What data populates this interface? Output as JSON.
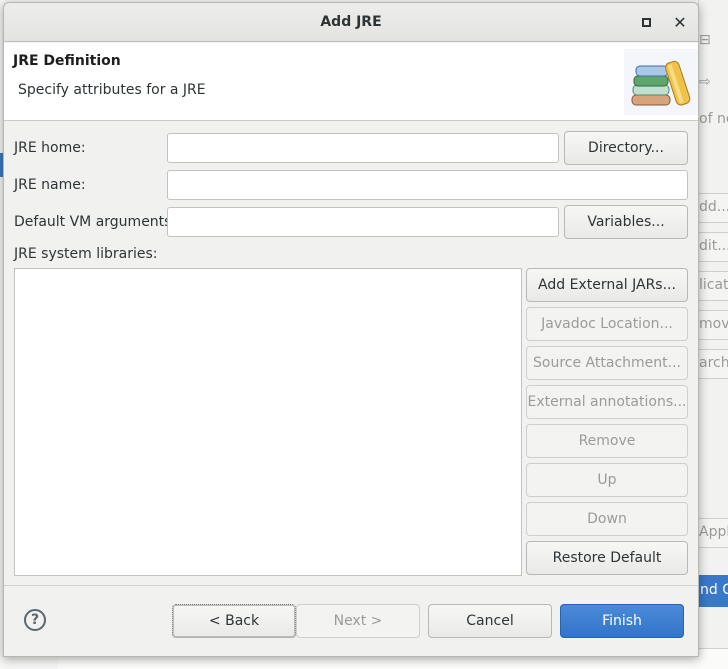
{
  "background": {
    "side_texts": [
      "of ne",
      "dd...",
      "dit...",
      "licat",
      "mov",
      "arch.",
      "Apply",
      "nd C"
    ]
  },
  "dialog": {
    "title": "Add JRE",
    "header": {
      "title": "JRE Definition",
      "description": "Specify attributes for a JRE"
    },
    "fields": {
      "jre_home": {
        "label": "JRE home:",
        "value": "",
        "button": "Directory..."
      },
      "jre_name": {
        "label": "JRE name:",
        "value": ""
      },
      "vm_args": {
        "label": "Default VM arguments:",
        "value": "",
        "button": "Variables..."
      }
    },
    "libraries": {
      "label": "JRE system libraries:",
      "items": [],
      "buttons": {
        "add_external_jars": "Add External JARs...",
        "javadoc_location": "Javadoc Location...",
        "source_attachment": "Source Attachment...",
        "external_annotations": "External annotations...",
        "remove": "Remove",
        "up": "Up",
        "down": "Down",
        "restore_default": "Restore Default"
      }
    },
    "footer": {
      "help": "?",
      "back": "< Back",
      "next": "Next >",
      "cancel": "Cancel",
      "finish": "Finish"
    },
    "colors": {
      "primary": "#3274c8",
      "disabled_text": "#9a9c9a"
    }
  }
}
